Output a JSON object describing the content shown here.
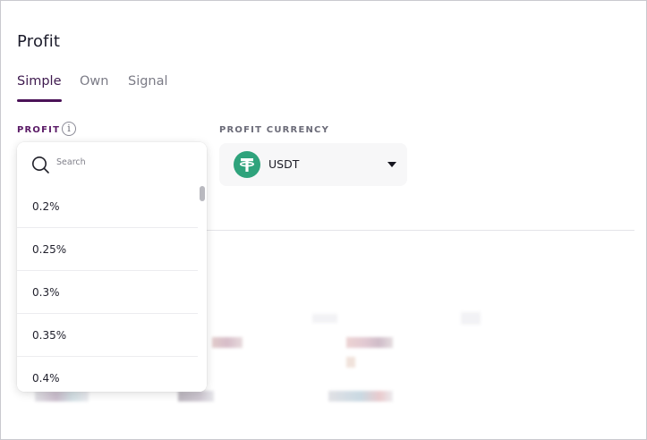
{
  "page": {
    "title": "Profit"
  },
  "tabs": [
    {
      "label": "Simple",
      "active": true
    },
    {
      "label": "Own",
      "active": false
    },
    {
      "label": "Signal",
      "active": false
    }
  ],
  "profit_field": {
    "label": "PROFIT",
    "info_icon": "info-icon",
    "info_glyph": "i",
    "dropdown": {
      "search_placeholder": "Search",
      "search_value": "",
      "options": [
        "0.2%",
        "0.25%",
        "0.3%",
        "0.35%",
        "0.4%"
      ]
    }
  },
  "currency_field": {
    "label": "PROFIT CURRENCY",
    "selected": "USDT",
    "icon": "tether-icon",
    "caret_icon": "caret-down-icon"
  },
  "colors": {
    "accent": "#4a1257",
    "tether_green": "#2fa37c",
    "panel_border": "#c9c9cf"
  }
}
